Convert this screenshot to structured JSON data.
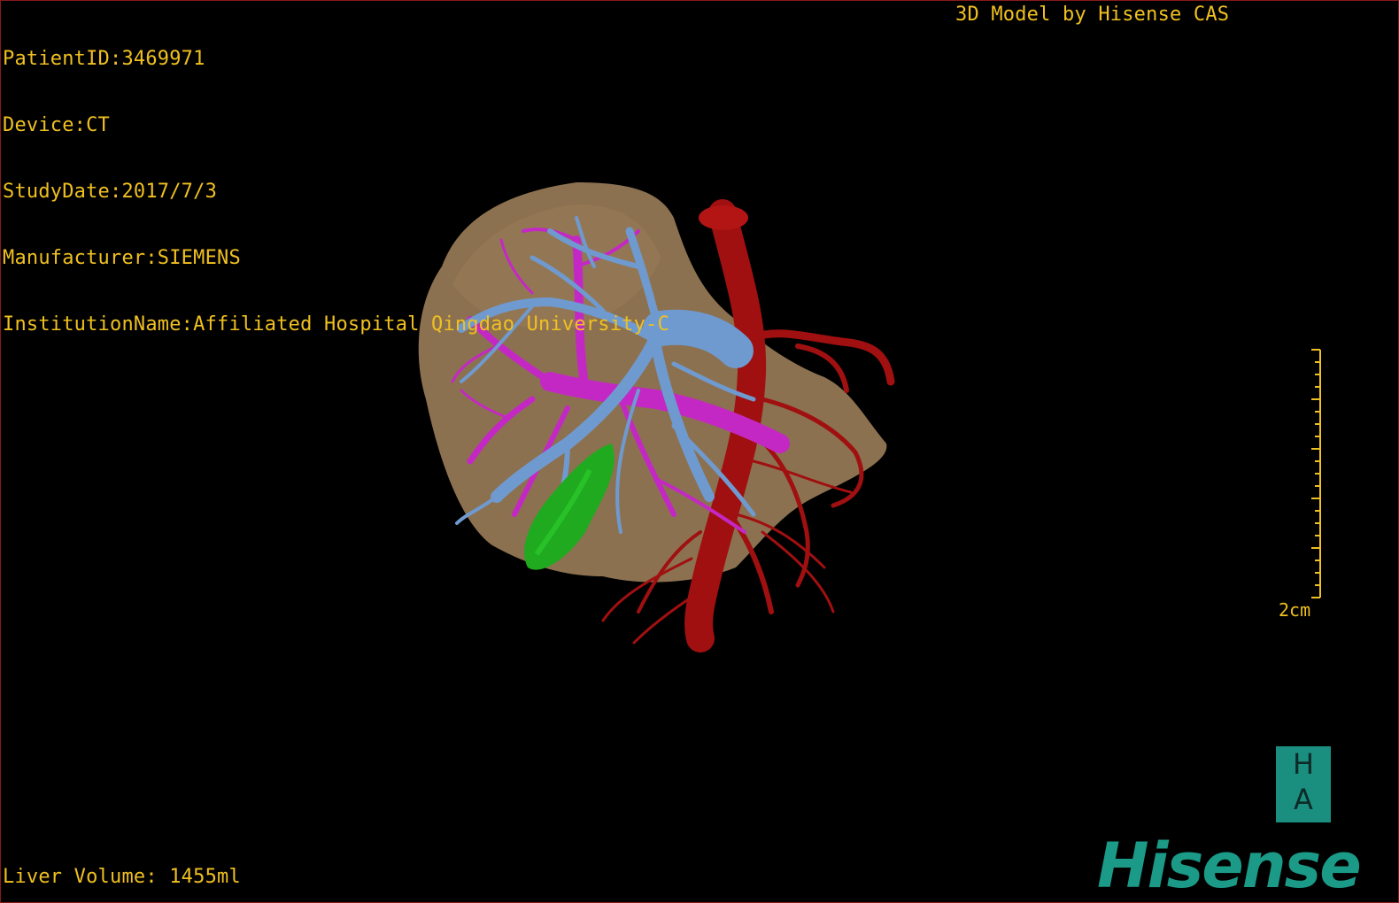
{
  "overlay": {
    "patient_id": "PatientID:3469971",
    "device": "Device:CT",
    "study_date": "StudyDate:2017/7/3",
    "manufacturer": "Manufacturer:SIEMENS",
    "institution": "InstitutionName:Affiliated Hospital Qingdao University-C",
    "credit": "3D Model by Hisense CAS",
    "liver_volume": "Liver Volume: 1455ml"
  },
  "scale": {
    "label": "2cm"
  },
  "logo": {
    "ha_top": "H",
    "ha_bottom": "A",
    "brand": "Hisense"
  },
  "colors": {
    "overlay_text": "#f0c020",
    "liver": "#8c7150",
    "portal_vein": "#c428c4",
    "hepatic_vein": "#6f9ad0",
    "artery": "#a01010",
    "gallbladder": "#1faa1f",
    "brand": "#1a9a87"
  }
}
